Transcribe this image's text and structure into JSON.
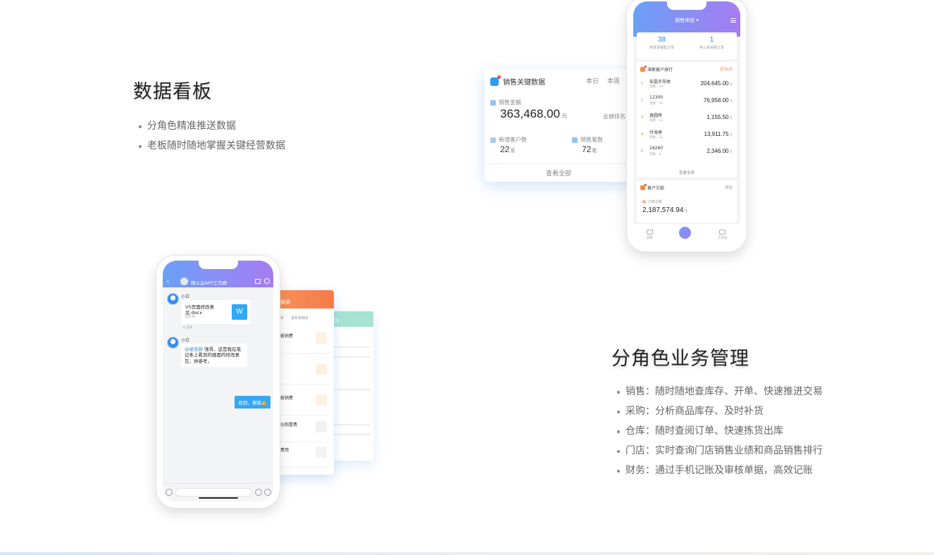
{
  "section1": {
    "title": "数据看板",
    "bullets": [
      "分角色精准推送数据",
      "老板随时随地掌握关键经营数据"
    ]
  },
  "section2": {
    "title": "分角色业务管理",
    "bullets": [
      "销售：随时随地查库存、开单、快速推进交易",
      "采购：分析商品库存、及时补货",
      "仓库：随时查阅订单、快速拣货出库",
      "门店：实时查询门店销售业绩和商品销售排行",
      "财务：通过手机记账及审核单据，高效记账"
    ]
  },
  "dashboard_card": {
    "title": "销售关键数据",
    "tabs": [
      "本日",
      "本周"
    ],
    "sales_label": "销售金额",
    "sales_value": "363,468.00",
    "sales_unit": "元",
    "rank_link": "业绩排名",
    "new_customers_label": "新增客户数",
    "new_customers_value": "22",
    "new_customers_unit": "家",
    "orders_label": "销售笔数",
    "orders_value": "72",
    "orders_unit": "笔",
    "view_all": "查看全部"
  },
  "phone_top": {
    "header_title": "销售体验",
    "stats": [
      {
        "value": "38",
        "label": "待发货销售订单"
      },
      {
        "value": "1",
        "label": "待入库采购订单"
      }
    ],
    "rank_title": "滞新客户排行",
    "rank_period": "近30天",
    "rank_rows": [
      {
        "no": "1",
        "name": "安晶半导体",
        "sub": "笔数：33",
        "value": "204,645.00",
        "unit": "元"
      },
      {
        "no": "2",
        "name": "12300",
        "sub": "笔数：24",
        "value": "76,958.00",
        "unit": "元"
      },
      {
        "no": "3",
        "name": "袁圆萍",
        "sub": "笔数：13",
        "value": "1,155.50",
        "unit": "元"
      },
      {
        "no": "4",
        "name": "付海承",
        "sub": "笔数：11",
        "value": "13,911.75",
        "unit": "元"
      },
      {
        "no": "5",
        "name": "18260",
        "sub": "笔数：9",
        "value": "2,346.00",
        "unit": "元"
      }
    ],
    "rank_view_all": "查看全部",
    "cust_title": "客户欠款",
    "cust_action": "添加",
    "cust_label": "欠款总额",
    "cust_value": "2,187,574.94",
    "cust_unit": "元",
    "tabbar": [
      "消息",
      "工作台"
    ]
  },
  "phone_bottom": {
    "group_title": "精斗云APP工作群",
    "sender1": "小白",
    "file_name": "V5页面修改意见.docx",
    "file_size": "100 M",
    "file_icon": "W",
    "read_mark": "◎ 已读",
    "sender2": "小白",
    "mention": "@梁竞新",
    "message": "强哥，这是我在笔记本上看到的画面的修改意见，供参考。",
    "reply": "收到，谢谢👍"
  },
  "float_card_orange": {
    "title": "报销",
    "tabs": [
      "单",
      "更新报销单"
    ],
    "items": [
      "报销费",
      "",
      "报销费",
      "仪购置费",
      "费用"
    ]
  },
  "float_card_green": {
    "title": "工单"
  },
  "colors": {
    "gradient_start": "#6aa0f6",
    "gradient_end": "#a67cf2",
    "accent_blue": "#2b86e0",
    "accent_orange": "#f07b3a"
  }
}
